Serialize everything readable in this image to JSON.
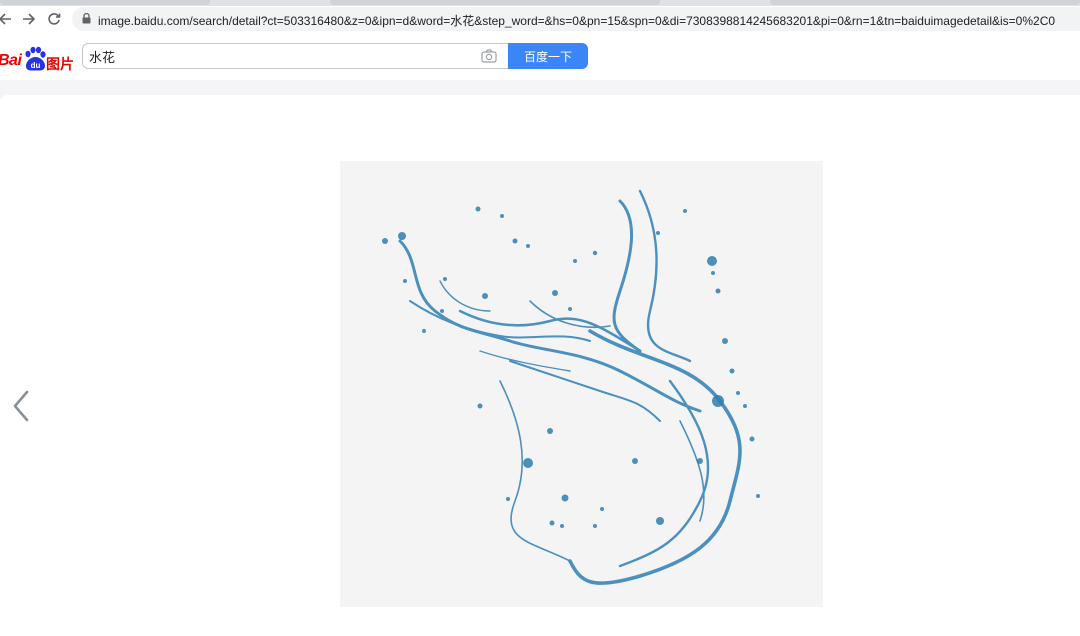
{
  "browser": {
    "url": "image.baidu.com/search/detail?ct=503316480&z=0&ipn=d&word=水花&step_word=&hs=0&pn=15&spn=0&di=7308398814245683201&pi=0&rn=1&tn=baiduimagedetail&is=0%2C0"
  },
  "header": {
    "logo_text_bai": "Bai",
    "logo_text_du": "du",
    "logo_text_tu": "图片",
    "search_value": "水花",
    "search_button_label": "百度一下"
  },
  "viewer": {
    "image_subject": "water-splash",
    "nav_prev_icon": "chevron-left-icon"
  },
  "colors": {
    "brand_red": "#e10601",
    "brand_blue": "#2932e1",
    "button_blue": "#3b86f7",
    "splash_blue": "#2f7fb0"
  }
}
